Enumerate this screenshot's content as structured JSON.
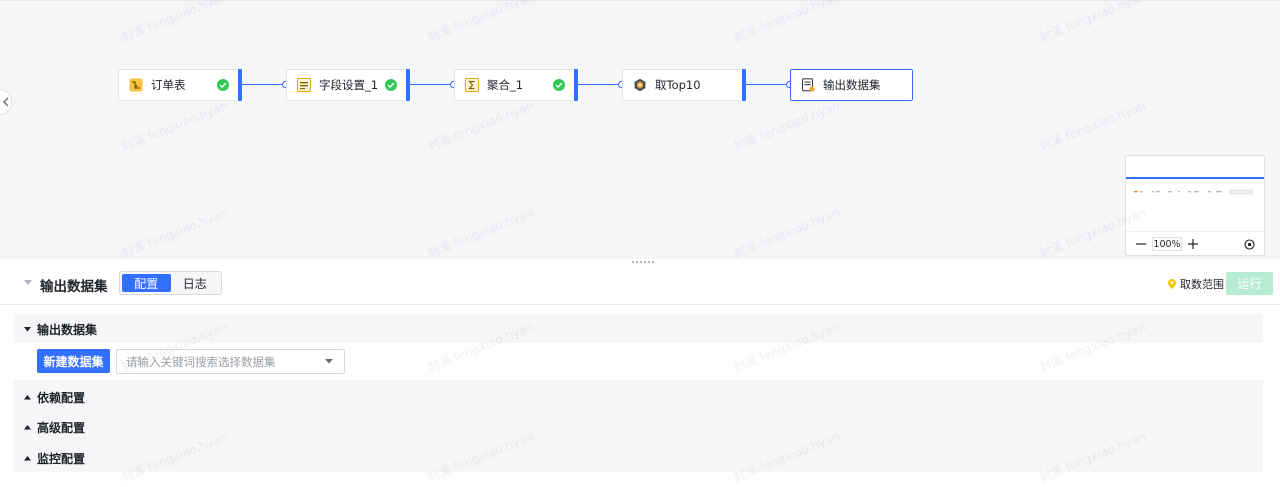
{
  "pipeline": {
    "nodes": [
      {
        "label": "订单表",
        "icon": "table-icon",
        "done": true
      },
      {
        "label": "字段设置_1",
        "icon": "field-settings-icon",
        "done": true
      },
      {
        "label": "聚合_1",
        "icon": "aggregate-icon",
        "done": true
      },
      {
        "label": "取Top10",
        "icon": "topn-icon",
        "done": false
      },
      {
        "label": "输出数据集",
        "icon": "output-dataset-icon",
        "done": false,
        "selected": true
      }
    ]
  },
  "minimap": {
    "zoom": "100%"
  },
  "panel": {
    "title": "输出数据集",
    "tabs": [
      {
        "label": "配置",
        "active": true
      },
      {
        "label": "日志",
        "active": false
      }
    ],
    "scope_label": "取数范围",
    "run_label": "运行"
  },
  "sections": {
    "output": {
      "title": "输出数据集",
      "expanded": true
    },
    "new_dataset_label": "新建数据集",
    "dataset_placeholder": "请输入关键词搜索选择数据集",
    "dependency": {
      "title": "依赖配置",
      "expanded": false
    },
    "advanced": {
      "title": "高级配置",
      "expanded": false
    },
    "monitor": {
      "title": "监控配置",
      "expanded": false
    }
  },
  "watermark": "封溪 fengxiao.hyan",
  "colors": {
    "accent": "#3370ff",
    "success": "#34c759",
    "run_disabled": "#b8ecd2",
    "scope_pin": "#f5c400"
  }
}
